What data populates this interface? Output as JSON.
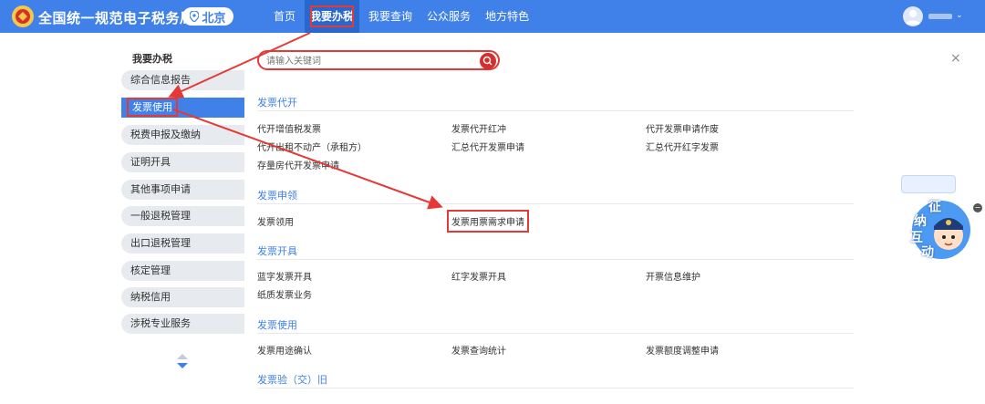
{
  "header": {
    "site_title": "全国统一规范电子税务局",
    "region": "北京",
    "nav": [
      "首页",
      "我要办税",
      "我要查询",
      "公众服务",
      "地方特色"
    ],
    "active_nav": "我要办税",
    "caret": "⌄",
    "brand_color": "#3f80e9",
    "highlight_color": "#e53935"
  },
  "sidebar": {
    "title": "我要办税",
    "items": [
      "综合信息报告",
      "发票使用",
      "税费申报及缴纳",
      "证明开具",
      "其他事项申请",
      "一般退税管理",
      "出口退税管理",
      "核定管理",
      "纳税信用",
      "涉税专业服务"
    ],
    "active_item": "发票使用"
  },
  "search": {
    "placeholder": "请输入关键词"
  },
  "close_glyph": "×",
  "sections": [
    {
      "title": "发票代开",
      "links": [
        "代开增值税发票",
        "发票代开红冲",
        "代开发票申请作废",
        "代开出租不动产（承租方）",
        "汇总代开发票申请",
        "汇总代开红字发票",
        "存量房代开发票申请"
      ]
    },
    {
      "title": "发票申领",
      "links": [
        "发票领用",
        "发票用票需求申请"
      ]
    },
    {
      "title": "发票开具",
      "links": [
        "蓝字发票开具",
        "红字发票开具",
        "开票信息维护",
        "纸质发票业务"
      ]
    },
    {
      "title": "发票使用",
      "links": [
        "发票用途确认",
        "发票查询统计",
        "发票额度调整申请"
      ]
    },
    {
      "title": "发票验（交）旧",
      "links": []
    }
  ],
  "widget": {
    "chars": [
      "征",
      "纳",
      "互",
      "动"
    ],
    "close_glyph": "−"
  }
}
